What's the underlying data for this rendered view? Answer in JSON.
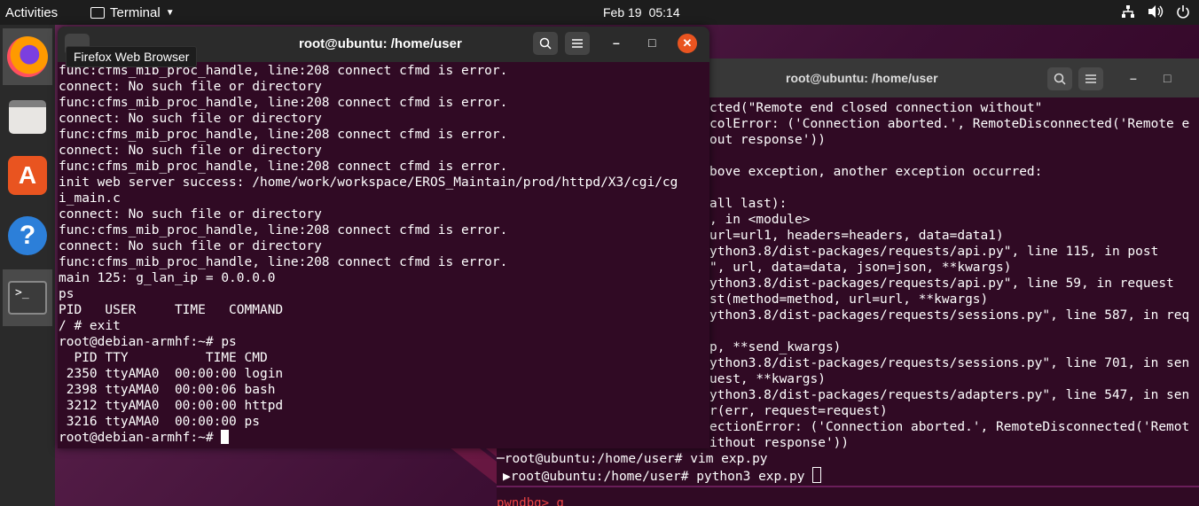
{
  "topbar": {
    "activities": "Activities",
    "app_name": "Terminal",
    "date": "Feb 19",
    "time": "05:14",
    "tray_icons": [
      "network-icon",
      "volume-icon",
      "power-icon"
    ]
  },
  "dock": {
    "items": [
      "firefox-icon",
      "files-icon",
      "software-store-icon",
      "help-icon",
      "terminal-icon"
    ]
  },
  "tooltip": "Firefox Web Browser",
  "front_terminal": {
    "title": "root@ubuntu: /home/user",
    "lines": [
      "func:cfms_mib_proc_handle, line:208 connect cfmd is error.",
      "connect: No such file or directory",
      "func:cfms_mib_proc_handle, line:208 connect cfmd is error.",
      "connect: No such file or directory",
      "func:cfms_mib_proc_handle, line:208 connect cfmd is error.",
      "connect: No such file or directory",
      "func:cfms_mib_proc_handle, line:208 connect cfmd is error.",
      "init web server success: /home/work/workspace/EROS_Maintain/prod/httpd/X3/cgi/cg",
      "i_main.c",
      "connect: No such file or directory",
      "func:cfms_mib_proc_handle, line:208 connect cfmd is error.",
      "connect: No such file or directory",
      "func:cfms_mib_proc_handle, line:208 connect cfmd is error.",
      "main 125: g_lan_ip = 0.0.0.0",
      "ps",
      "PID   USER     TIME   COMMAND",
      "/ # exit",
      "root@debian-armhf:~# ps",
      "  PID TTY          TIME CMD",
      " 2350 ttyAMA0  00:00:00 login",
      " 2398 ttyAMA0  00:00:06 bash",
      " 3212 ttyAMA0  00:00:00 httpd",
      " 3216 ttyAMA0  00:00:00 ps"
    ],
    "prompt": "root@debian-armhf:~# "
  },
  "back_terminal": {
    "title": "root@ubuntu: /home/user",
    "lines": [
      "cted(\"Remote end closed connection without\"",
      "colError: ('Connection aborted.', RemoteDisconnected('Remote e",
      "out response'))",
      "",
      "bove exception, another exception occurred:",
      "",
      "all last):",
      ", in <module>",
      "url=url1, headers=headers, data=data1)",
      "ython3.8/dist-packages/requests/api.py\", line 115, in post",
      "\", url, data=data, json=json, **kwargs)",
      "ython3.8/dist-packages/requests/api.py\", line 59, in request",
      "st(method=method, url=url, **kwargs)",
      "ython3.8/dist-packages/requests/sessions.py\", line 587, in req",
      "",
      "p, **send_kwargs)",
      "ython3.8/dist-packages/requests/sessions.py\", line 701, in sen",
      "uest, **kwargs)",
      "ython3.8/dist-packages/requests/adapters.py\", line 547, in sen",
      "r(err, request=request)",
      "ectionError: ('Connection aborted.', RemoteDisconnected('Remot",
      "ithout response'))"
    ],
    "cmd_line_1": "─root@ubuntu:/home/user# vim exp.py",
    "cmd_line_2": "▶root@ubuntu:/home/user# python3 exp.py ",
    "pwndbg": "pwndbg> q"
  }
}
